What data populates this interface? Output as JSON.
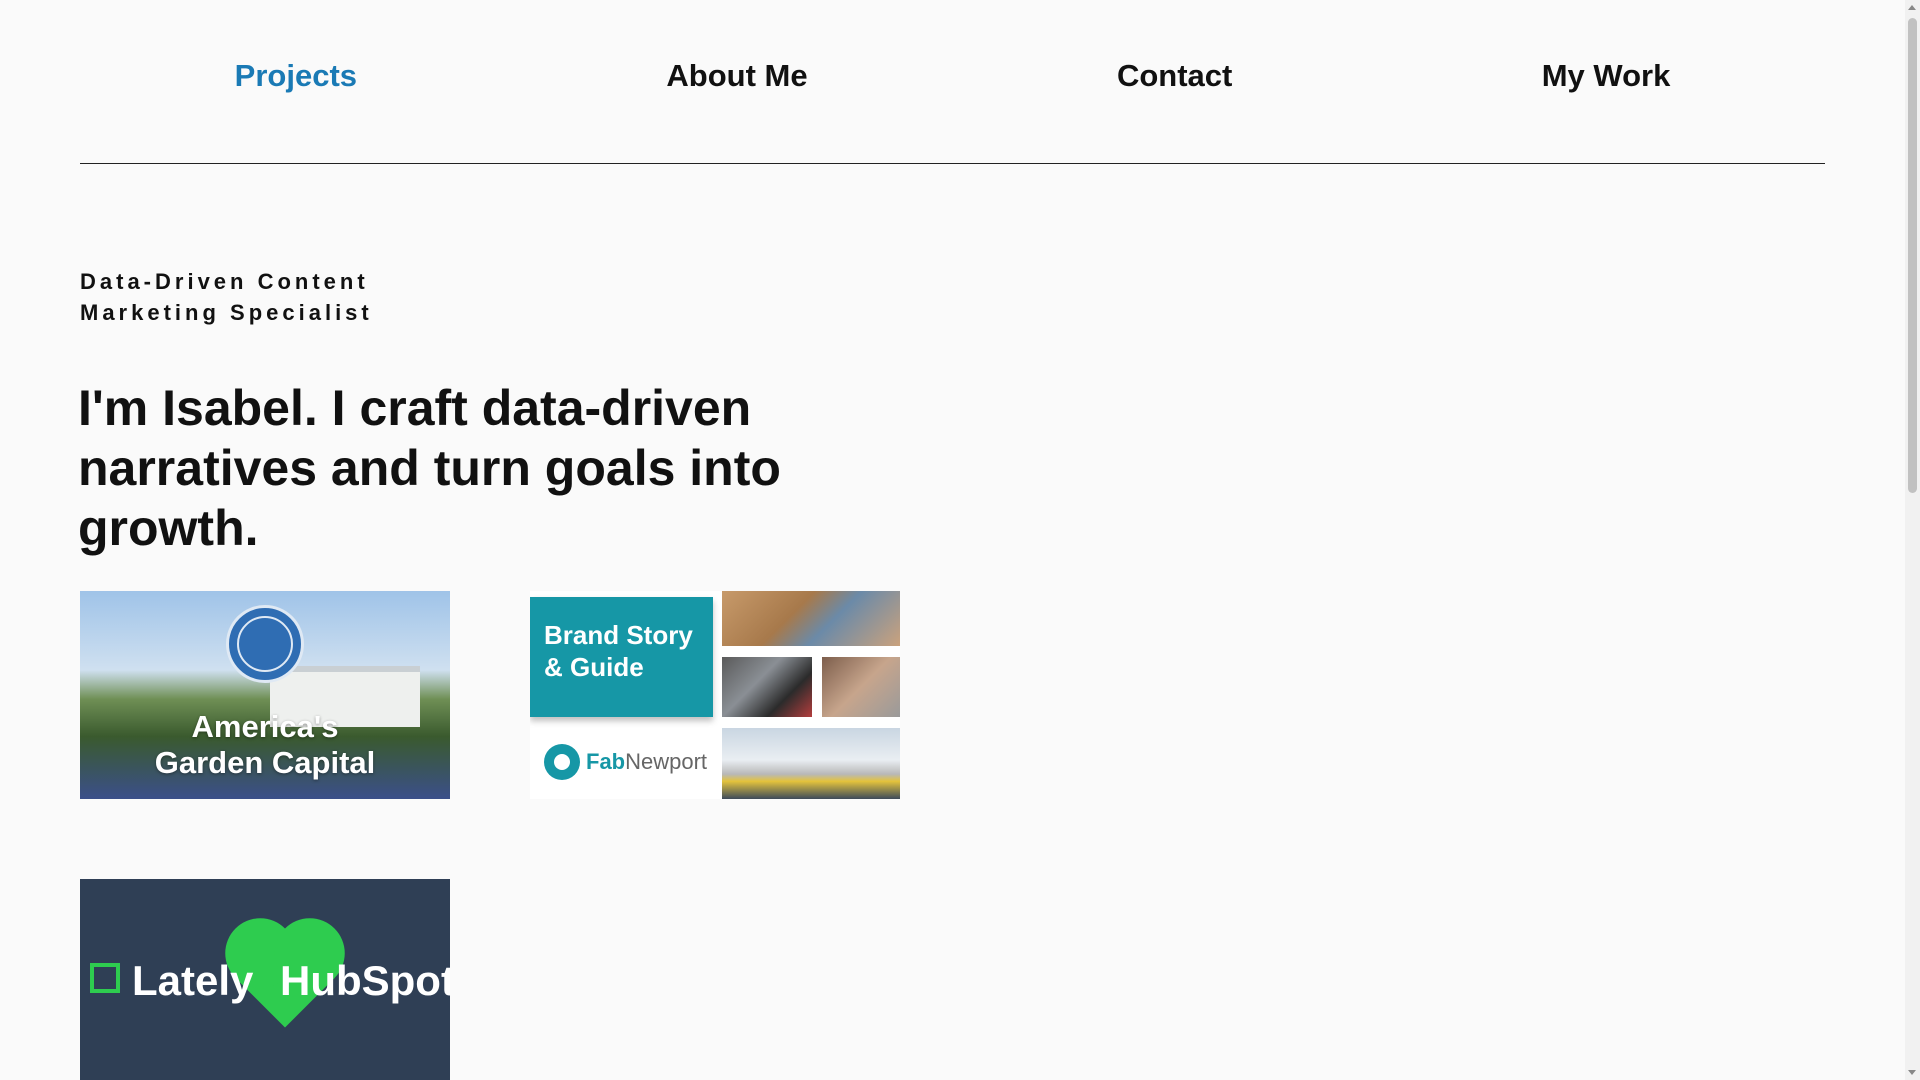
{
  "nav": {
    "items": [
      {
        "label": "Projects",
        "active": true
      },
      {
        "label": "About Me",
        "active": false
      },
      {
        "label": "Contact",
        "active": false
      },
      {
        "label": "My Work",
        "active": false
      }
    ],
    "active_color": "#1a7ab5"
  },
  "hero": {
    "eyebrow": "Data-Driven Content Marketing Specialist",
    "headline": "I'm Isabel. I craft data-driven narratives and turn goals into growth."
  },
  "cards": {
    "garden": {
      "title_line1": "America's",
      "title_line2": "Garden Capital",
      "icon": "little-rhody-badge-icon"
    },
    "brand": {
      "title_line1": "Brand Story",
      "title_line2": "& Guide",
      "logo_bold": "Fab",
      "logo_light": "Newport",
      "accent": "#1697a6"
    },
    "hubspot": {
      "lately": "Lately",
      "hubspot": "HubSpot",
      "accent": "#2ecc4f",
      "background": "#2f3f55"
    }
  }
}
